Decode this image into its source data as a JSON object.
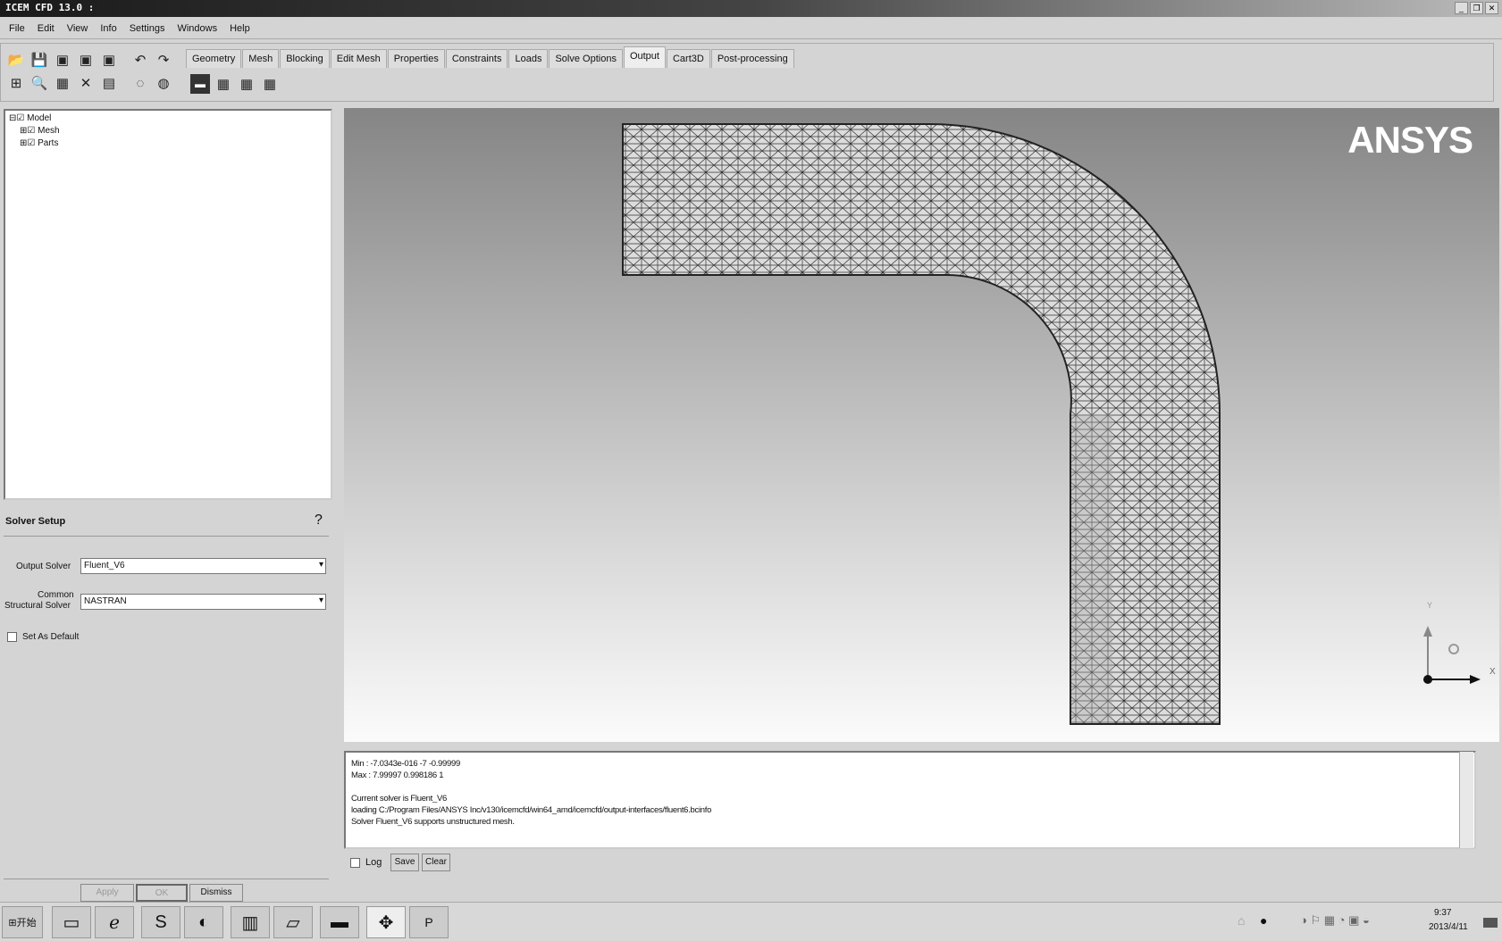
{
  "window": {
    "title": "ICEM CFD 13.0 :"
  },
  "menu": [
    "File",
    "Edit",
    "View",
    "Info",
    "Settings",
    "Windows",
    "Help"
  ],
  "tabs": [
    "Geometry",
    "Mesh",
    "Blocking",
    "Edit Mesh",
    "Properties",
    "Constraints",
    "Loads",
    "Solve Options",
    "Output",
    "Cart3D",
    "Post-processing"
  ],
  "active_tab": "Output",
  "tree": {
    "root": "Model",
    "children": [
      "Mesh",
      "Parts"
    ]
  },
  "solver_setup": {
    "title": "Solver Setup",
    "output_solver_label": "Output Solver",
    "output_solver_value": "Fluent_V6",
    "common_label_1": "Common",
    "common_label_2": "Structural Solver",
    "common_value": "NASTRAN",
    "set_default_label": "Set As Default",
    "apply": "Apply",
    "ok": "OK",
    "dismiss": "Dismiss"
  },
  "viewport": {
    "logo": "ANSYS",
    "axis_x": "X",
    "axis_y": "Y"
  },
  "console": {
    "lines": [
      "Min : -7.0343e-016 -7 -0.99999",
      "Max : 7.99997 0.998186 1",
      "",
      "Current solver is Fluent_V6",
      "loading C:/Program Files/ANSYS Inc/v130/icemcfd/win64_amd/icemcfd/output-interfaces/fluent6.bcinfo",
      "Solver Fluent_V6 supports unstructured mesh."
    ],
    "log": "Log",
    "save": "Save",
    "clear": "Clear"
  },
  "taskbar": {
    "start": "开始",
    "time": "9:37",
    "date": "2013/4/11"
  }
}
